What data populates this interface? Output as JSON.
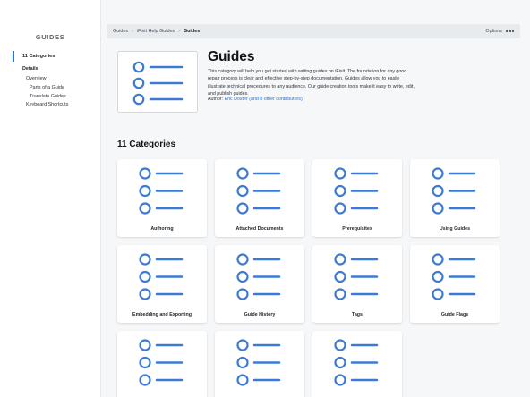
{
  "sidebar": {
    "title": "GUIDES",
    "active_item": "11 Categories",
    "items": [
      {
        "label": "Details",
        "level": 0
      },
      {
        "label": "Overview",
        "level": 1
      },
      {
        "label": "Parts of a Guide",
        "level": 2
      },
      {
        "label": "Translate Guides",
        "level": 2
      },
      {
        "label": "Keyboard Shortcuts",
        "level": 1
      }
    ]
  },
  "breadcrumb": {
    "items": [
      "Guides",
      "iFixit Help Guides",
      "Guides"
    ],
    "options_label": "Options"
  },
  "header": {
    "icon": "list-icon",
    "title": "Guides",
    "description": "This category will help you get started with writing guides on iFixit. The foundation for any good repair process is clear and effective step-by-step documentation. Guides allow you to easily illustrate technical procedures to any audience. Our guide creation tools make it easy to write, edit, and publish guides.",
    "author_prefix": "Author:",
    "author_link": "Eric Doster (and 8 other contributors)"
  },
  "categories_heading": "11 Categories",
  "categories": [
    {
      "label": "Authoring",
      "icon": "list-icon"
    },
    {
      "label": "Attached Documents",
      "icon": "list-icon"
    },
    {
      "label": "Prerequisites",
      "icon": "list-icon"
    },
    {
      "label": "Using Guides",
      "icon": "list-icon"
    },
    {
      "label": "Embedding and Exporting",
      "icon": "list-icon"
    },
    {
      "label": "Guide History",
      "icon": "list-icon"
    },
    {
      "label": "Tags",
      "icon": "list-icon"
    },
    {
      "label": "Guide Flags",
      "icon": "list-icon"
    },
    {
      "label": "",
      "icon": "list-icon"
    },
    {
      "label": "",
      "icon": "list-icon"
    },
    {
      "label": "",
      "icon": "list-icon"
    }
  ],
  "colors": {
    "accent": "#1975f2",
    "icon_blue": "#3d7ad6",
    "page_bg": "#f5f7f9",
    "breadcrumb_bg": "#e8ebee"
  }
}
